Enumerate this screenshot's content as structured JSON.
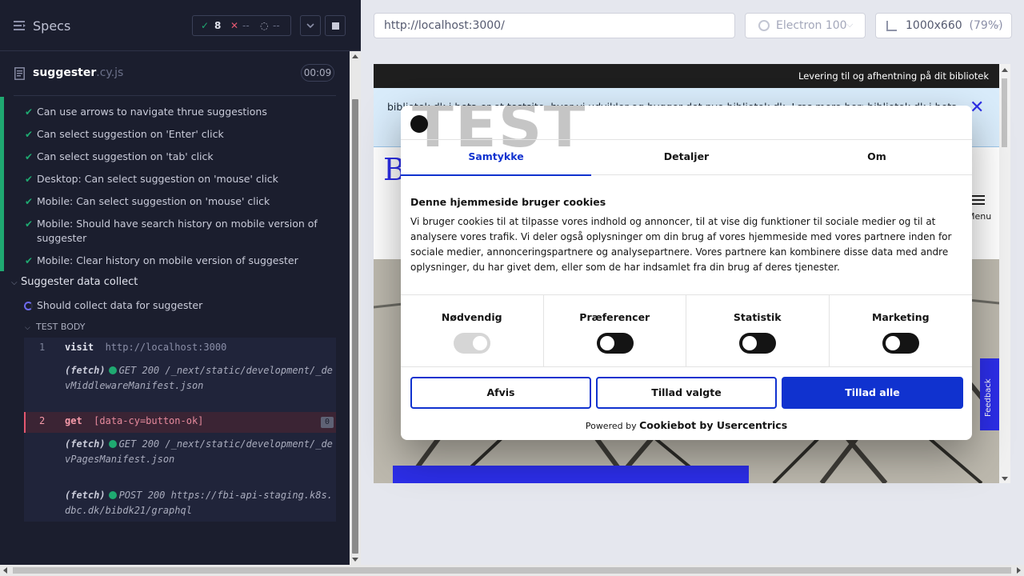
{
  "header": {
    "title": "Specs",
    "passed_icon": "✓",
    "passed_count": "8",
    "failed_icon": "✕",
    "failed_count": "--",
    "pending_icon": "◌",
    "pending_count": "--"
  },
  "spec_file": {
    "name": "suggester",
    "ext": ".cy.js",
    "duration": "00:09"
  },
  "tests": [
    {
      "label": "Can use arrows to navigate thrue suggestions"
    },
    {
      "label": "Can select suggestion on 'Enter' click"
    },
    {
      "label": "Can select suggestion on 'tab' click"
    },
    {
      "label": "Desktop: Can select suggestion on 'mouse' click"
    },
    {
      "label": "Mobile: Can select suggestion on 'mouse' click"
    },
    {
      "label": "Mobile: Should have search history on mobile version of suggester"
    },
    {
      "label": "Mobile: Clear history on mobile version of suggester"
    }
  ],
  "suite": {
    "label": "Suggester data collect",
    "running_test": "Should collect data for suggester",
    "test_body_label": "TEST BODY"
  },
  "commands": {
    "c1_num": "1",
    "c1_name": "visit",
    "c1_arg": "http://localhost:3000",
    "f1_label": "(fetch)",
    "f1_text": "GET 200 /_next/static/development/_devMiddlewareManifest.json",
    "c2_num": "2",
    "c2_name": "get",
    "c2_arg": "[data-cy=button-ok]",
    "c2_badge": "0",
    "f2_label": "(fetch)",
    "f2_text": "GET 200 /_next/static/development/_devPagesManifest.json",
    "f3_label": "(fetch)",
    "f3_text": "POST 200 https://fbi-api-staging.k8s.dbc.dk/bibdk21/graphql"
  },
  "toolbar": {
    "url": "http://localhost:3000/",
    "browser": "Electron 100",
    "viewport": "1000x660",
    "zoom": "(79%)"
  },
  "app": {
    "top_bar": "Levering til og afhentning på dit bibliotek",
    "banner": "bibliotek.dk i beta er et testsite, hvor vi udvikler og bygger det nye bibliotek.dk. Læs mere her: bibliotek.dk i beta",
    "close": "✕",
    "menu_label": "Menu",
    "feedback": "Feedback"
  },
  "cookie": {
    "watermark": "TEST",
    "tabs": [
      "Samtykke",
      "Detaljer",
      "Om"
    ],
    "heading": "Denne hjemmeside bruger cookies",
    "body": "Vi bruger cookies til at tilpasse vores indhold og annoncer, til at vise dig funktioner til sociale medier og til at analysere vores trafik. Vi deler også oplysninger om din brug af vores hjemmeside med vores partnere inden for sociale medier, annonceringspartnere og analysepartnere. Vores partnere kan kombinere disse data med andre oplysninger, du har givet dem, eller som de har indsamlet fra din brug af deres tjenester.",
    "categories": [
      "Nødvendig",
      "Præferencer",
      "Statistik",
      "Marketing"
    ],
    "btn_reject": "Afvis",
    "btn_selected": "Tillad valgte",
    "btn_all": "Tillad alle",
    "powered_prefix": "Powered by",
    "powered_brand": "Cookiebot by Usercentrics"
  },
  "colors": {
    "panel_bg": "#1b1e2e",
    "pass": "#1fa971",
    "fail": "#e45770",
    "brand_blue": "#1032cf"
  }
}
